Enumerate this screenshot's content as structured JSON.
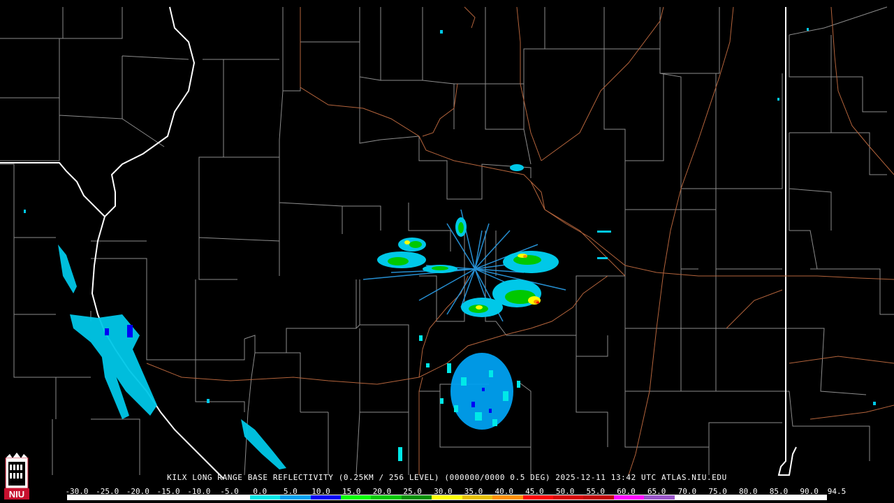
{
  "product": {
    "station": "KILX",
    "title_line": "KILX LONG RANGE BASE REFLECTIVITY (0.25KM / 256 LEVEL) (000000/0000 0.5 DEG) 2025-12-11 13:42 UTC  ATLAS.NIU.EDU"
  },
  "logo": {
    "text": "NIU",
    "color": "#c8102e"
  },
  "colorbar": {
    "ticks": [
      "-30.0",
      "-25.0",
      "-20.0",
      "-15.0",
      "-10.0",
      "-5.0",
      "0.0",
      "5.0",
      "10.0",
      "15.0",
      "20.0",
      "25.0",
      "30.0",
      "35.0",
      "40.0",
      "45.0",
      "50.0",
      "55.0",
      "60.0",
      "65.0",
      "70.0",
      "75.0",
      "80.0",
      "85.0",
      "90.0",
      "94.5"
    ],
    "colors": [
      "#ffffff",
      "#ffffff",
      "#ffffff",
      "#ffffff",
      "#ffffff",
      "#ffffff",
      "#00e8e8",
      "#00a0f0",
      "#0000f6",
      "#00ff00",
      "#00c800",
      "#009000",
      "#ffff00",
      "#e7c000",
      "#ff9000",
      "#ff0000",
      "#d60000",
      "#c00000",
      "#ff00ff",
      "#9955c9",
      "#ffffff",
      "#ffffff",
      "#ffffff",
      "#ffffff",
      "#ffffff"
    ]
  },
  "map_colors": {
    "county": "#8c8c8c",
    "state": "#ffffff",
    "highway": "#b4643c",
    "background": "#000000"
  }
}
